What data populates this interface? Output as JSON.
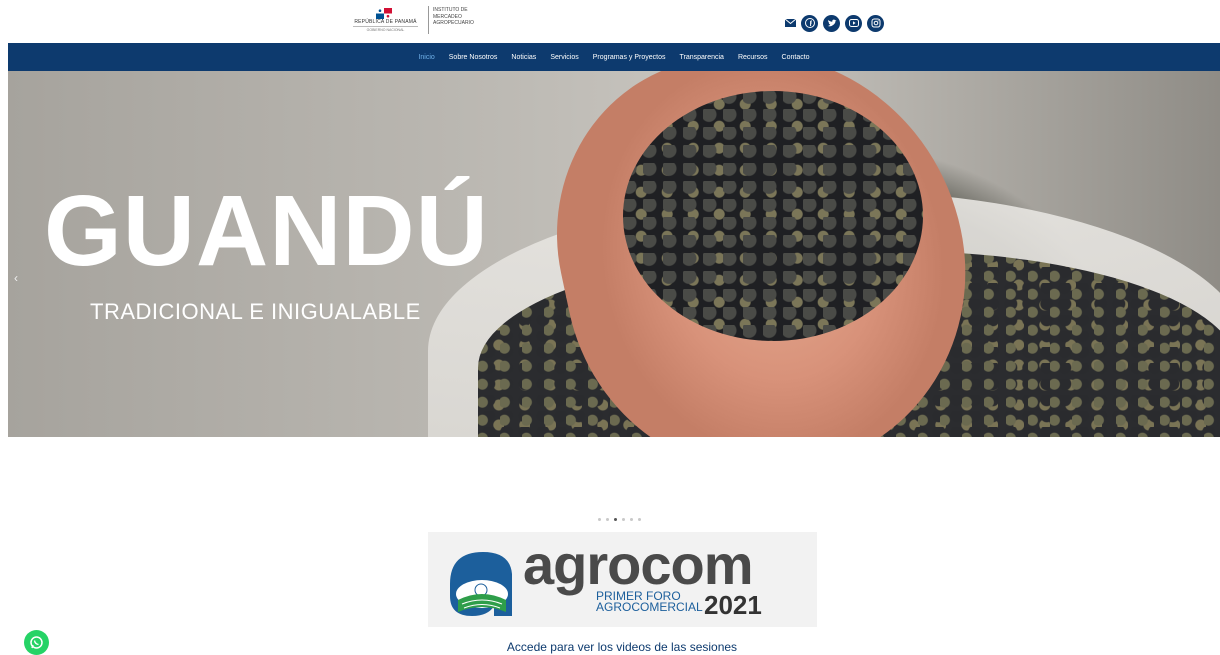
{
  "header": {
    "gov_logo_text": "REPÚBLICA DE PANAMÁ",
    "gov_logo_sub": "GOBIERNO NACIONAL",
    "ima_lines": [
      "INSTITUTO DE",
      "MERCADEO",
      "AGROPECUARIO"
    ],
    "socials": [
      {
        "name": "mail-icon"
      },
      {
        "name": "facebook-icon"
      },
      {
        "name": "twitter-icon"
      },
      {
        "name": "youtube-icon"
      },
      {
        "name": "instagram-icon"
      }
    ],
    "brand_color": "#0d3a6e"
  },
  "nav": {
    "items": [
      {
        "label": "Inicio",
        "active": true
      },
      {
        "label": "Sobre Nosotros"
      },
      {
        "label": "Noticias"
      },
      {
        "label": "Servicios"
      },
      {
        "label": "Programas y Proyectos"
      },
      {
        "label": "Transparencia"
      },
      {
        "label": "Recursos"
      },
      {
        "label": "Contacto"
      }
    ]
  },
  "hero": {
    "title": "GUANDÚ",
    "subtitle": "TRADICIONAL E INIGUALABLE",
    "prev_arrow": "‹"
  },
  "slider": {
    "total_dots": 6,
    "active_index": 2
  },
  "banner": {
    "word": "agrocom",
    "sub_line1": "PRIMER FORO",
    "sub_line2": "AGROCOMERCIAL",
    "year": "2021",
    "caption": "Accede para ver los videos de las sesiones"
  },
  "floating": {
    "whatsapp": "whatsapp-icon"
  }
}
